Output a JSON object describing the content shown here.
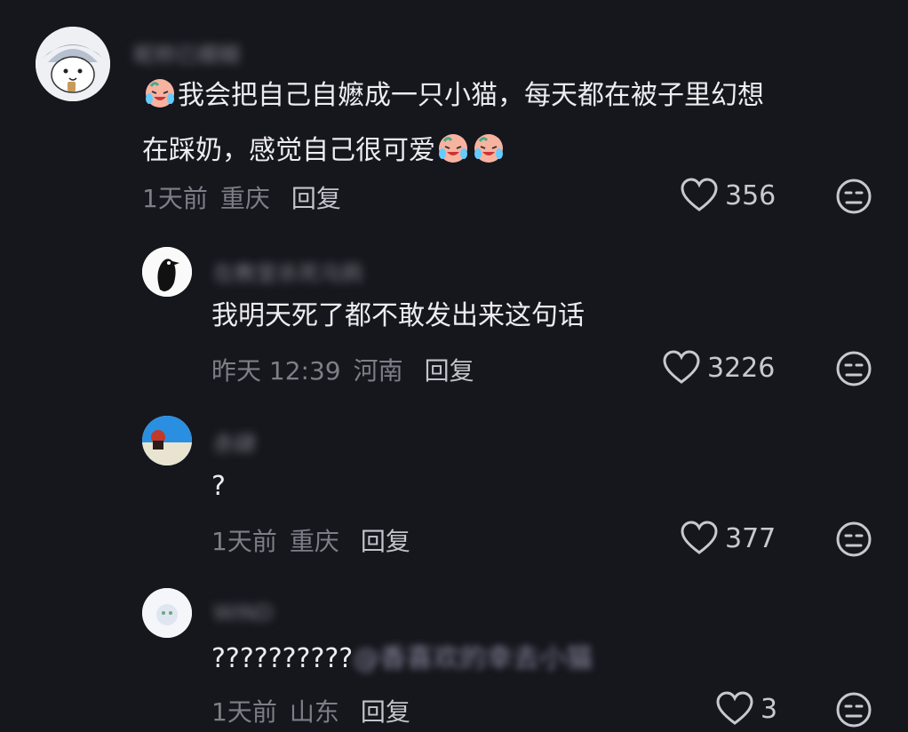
{
  "comments": [
    {
      "name": "昵称已模糊",
      "text_before_emoji": "",
      "line1": "我会把自己自嬷成一只小猫，每天都在被子里幻想",
      "line2": "在踩奶，感觉自己很可爱",
      "time": "1天前",
      "location": "重庆",
      "reply_label": "回复",
      "likes": "356"
    },
    {
      "name": "在教室杀死乌鸦",
      "text": "我明天死了都不敢发出来这句话",
      "time": "昨天 12:39",
      "location": "河南",
      "reply_label": "回复",
      "likes": "3226"
    },
    {
      "name": "赤肆",
      "text": "?",
      "time": "1天前",
      "location": "重庆",
      "reply_label": "回复",
      "likes": "377"
    },
    {
      "name": "WIND",
      "text": "??????????",
      "mention": "@香喜欢的幸去小猫",
      "time": "1天前",
      "location": "山东",
      "reply_label": "回复",
      "likes": "3"
    }
  ],
  "icons": {
    "like": "heart-outline-icon",
    "dislike": "meh-face-icon",
    "emoji": "crying-laughing-emoji"
  },
  "colors": {
    "background": "#16161d",
    "meta": "#7e7e88",
    "text": "#ececf1"
  }
}
